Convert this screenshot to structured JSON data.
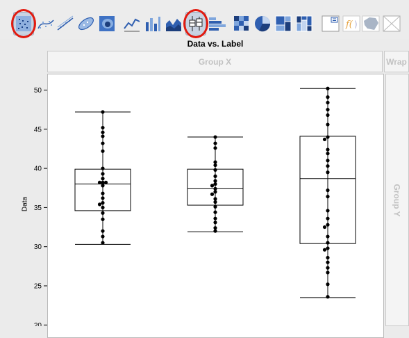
{
  "toolbar": {
    "buttons": [
      {
        "name": "points-button",
        "icon": "points-icon",
        "selected": true
      },
      {
        "name": "smoother-button",
        "icon": "smoother-icon",
        "selected": false
      },
      {
        "name": "line-of-fit-button",
        "icon": "line-of-fit-icon",
        "selected": false
      },
      {
        "name": "ellipse-button",
        "icon": "ellipse-icon",
        "selected": false
      },
      {
        "name": "contour-button",
        "icon": "contour-icon",
        "selected": false
      },
      {
        "name": "line-button",
        "icon": "line-chart-icon",
        "selected": false
      },
      {
        "name": "bar-button",
        "icon": "bar-chart-icon",
        "selected": false
      },
      {
        "name": "area-button",
        "icon": "area-chart-icon",
        "selected": false
      },
      {
        "name": "box-plot-button",
        "icon": "box-plot-icon",
        "selected": true
      },
      {
        "name": "histogram-button",
        "icon": "histogram-icon",
        "selected": false
      },
      {
        "name": "heatmap-button",
        "icon": "heatmap-icon",
        "selected": false
      },
      {
        "name": "pie-button",
        "icon": "pie-chart-icon",
        "selected": false
      },
      {
        "name": "treemap-button",
        "icon": "treemap-icon",
        "selected": false
      },
      {
        "name": "mosaic-button",
        "icon": "mosaic-icon",
        "selected": false
      },
      {
        "name": "caption-box-button",
        "icon": "caption-box-icon",
        "selected": false
      },
      {
        "name": "formula-button",
        "icon": "formula-icon",
        "selected": false
      },
      {
        "name": "map-shapes-button",
        "icon": "map-shapes-icon",
        "selected": false
      },
      {
        "name": "custom-button",
        "icon": "custom-icon",
        "selected": false
      }
    ],
    "highlight_color": "#e21b10"
  },
  "drop_zones": {
    "group_x": "Group X",
    "wrap": "Wrap",
    "group_y": "Group Y"
  },
  "chart_data": {
    "type": "box",
    "title": "Data vs. Label",
    "ylabel": "Data",
    "ylim": [
      20,
      52
    ],
    "yticks": [
      20,
      25,
      30,
      35,
      40,
      45,
      50
    ],
    "grid": false,
    "groups": [
      {
        "box": {
          "min": 30.3,
          "q1": 34.6,
          "median": 38.0,
          "q3": 39.9,
          "max": 47.2
        },
        "points": [
          47.2,
          45.2,
          44.6,
          44.1,
          43.2,
          42.2,
          40.0,
          39.3,
          38.7,
          38.2,
          38.2,
          38.2,
          37.8,
          36.8,
          36.2,
          35.6,
          35.4,
          35.0,
          34.3,
          33.5,
          32.0,
          31.3,
          30.5
        ]
      },
      {
        "box": {
          "min": 31.9,
          "q1": 35.3,
          "median": 37.4,
          "q3": 39.9,
          "max": 44.0
        },
        "points": [
          44.0,
          43.2,
          42.6,
          40.8,
          40.4,
          39.8,
          39.0,
          38.4,
          38.0,
          37.8,
          37.4,
          37.0,
          36.7,
          36.1,
          35.7,
          35.1,
          34.4,
          33.6,
          33.1,
          32.4,
          32.0
        ]
      },
      {
        "box": {
          "min": 23.5,
          "q1": 30.4,
          "median": 38.7,
          "q3": 44.1,
          "max": 50.2
        },
        "points": [
          50.2,
          49.1,
          48.4,
          47.5,
          46.8,
          45.6,
          44.0,
          43.7,
          42.4,
          41.9,
          41.0,
          40.3,
          39.5,
          37.2,
          36.4,
          34.6,
          33.6,
          32.8,
          32.5,
          31.3,
          30.5,
          29.8,
          29.6,
          28.6,
          28.0,
          27.3,
          26.7,
          25.2,
          23.6
        ]
      }
    ]
  }
}
